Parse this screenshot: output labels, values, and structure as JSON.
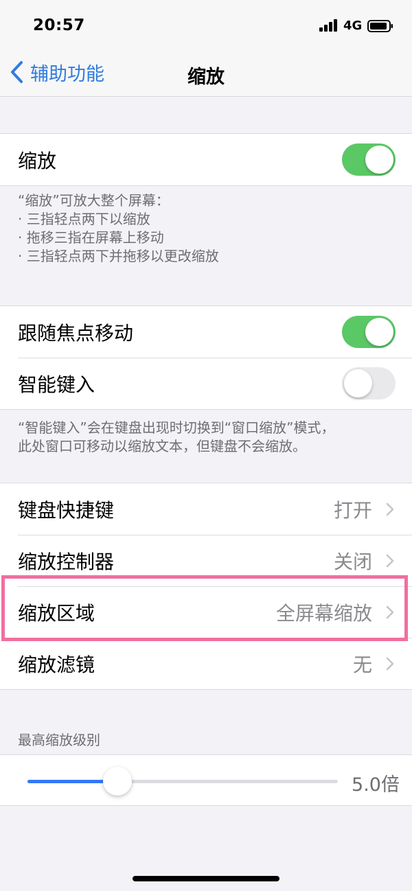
{
  "status_bar": {
    "time": "20:57",
    "network": "4G"
  },
  "nav": {
    "back_label": "辅助功能",
    "title": "缩放"
  },
  "zoom_section": {
    "label": "缩放",
    "enabled": true,
    "footer_title": "“缩放”可放大整个屏幕：",
    "footer_bullets": [
      "三指轻点两下以缩放",
      "拖移三指在屏幕上移动",
      "三指轻点两下并拖移以更改缩放"
    ]
  },
  "focus_section": {
    "follow_focus": {
      "label": "跟随焦点移动",
      "enabled": true
    },
    "smart_typing": {
      "label": "智能键入",
      "enabled": false
    },
    "footer_line1": "“智能键入”会在键盘出现时切换到“窗口缩放”模式，",
    "footer_line2": "此处窗口可移动以缩放文本，但键盘不会缩放。"
  },
  "options": [
    {
      "label": "键盘快捷键",
      "value": "打开"
    },
    {
      "label": "缩放控制器",
      "value": "关闭"
    },
    {
      "label": "缩放区域",
      "value": "全屏幕缩放"
    },
    {
      "label": "缩放滤镜",
      "value": "无"
    }
  ],
  "max_zoom": {
    "header": "最高缩放级别",
    "value_label": "5.0倍",
    "fraction": 0.29
  },
  "colors": {
    "accent": "#3478f6",
    "toggle_on": "#5bc866",
    "highlight": "#f06fa0"
  }
}
